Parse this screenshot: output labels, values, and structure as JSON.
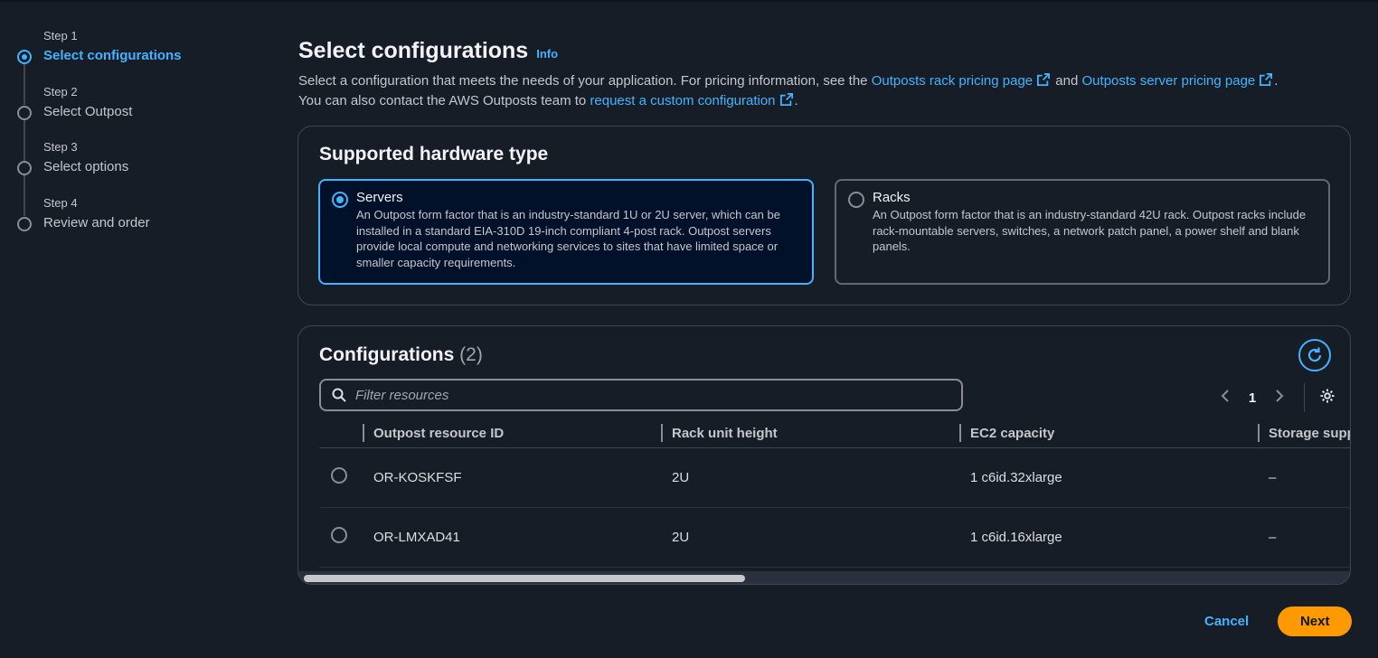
{
  "steps": [
    {
      "num": "Step 1",
      "title": "Select configurations",
      "active": true
    },
    {
      "num": "Step 2",
      "title": "Select Outpost",
      "active": false
    },
    {
      "num": "Step 3",
      "title": "Select options",
      "active": false
    },
    {
      "num": "Step 4",
      "title": "Review and order",
      "active": false
    }
  ],
  "header": {
    "title": "Select configurations",
    "info": "Info",
    "desc_1": "Select a configuration that meets the needs of your application. For pricing information, see the ",
    "link_rack": "Outposts rack pricing page",
    "desc_and": " and ",
    "link_server": "Outposts server pricing page",
    "desc_2": ".",
    "desc_3": "You can also contact the AWS Outposts team to ",
    "link_custom": "request a custom configuration",
    "desc_4": "."
  },
  "hardware": {
    "title": "Supported hardware type",
    "options": [
      {
        "label": "Servers",
        "selected": true,
        "desc": "An Outpost form factor that is an industry-standard 1U or 2U server, which can be installed in a standard EIA-310D 19-inch compliant 4-post rack. Outpost servers provide local compute and networking services to sites that have limited space or smaller capacity requirements."
      },
      {
        "label": "Racks",
        "selected": false,
        "desc": "An Outpost form factor that is an industry-standard 42U rack. Outpost racks include rack-mountable servers, switches, a network patch panel, a power shelf and blank panels."
      }
    ]
  },
  "configs": {
    "title": "Configurations",
    "count": "(2)",
    "search_placeholder": "Filter resources",
    "page": "1",
    "columns": [
      "Outpost resource ID",
      "Rack unit height",
      "EC2 capacity",
      "Storage supp"
    ],
    "rows": [
      [
        "OR-KOSKFSF",
        "2U",
        "1 c6id.32xlarge",
        "–"
      ],
      [
        "OR-LMXAD41",
        "2U",
        "1 c6id.16xlarge",
        "–"
      ]
    ]
  },
  "actions": {
    "cancel": "Cancel",
    "next": "Next"
  },
  "colors": {
    "accent": "#42b4ff",
    "primary": "#ff9900",
    "background": "#161d26"
  },
  "icons": [
    "external-link-icon",
    "refresh-icon",
    "search-icon",
    "chevron-left-icon",
    "chevron-right-icon",
    "gear-icon"
  ]
}
